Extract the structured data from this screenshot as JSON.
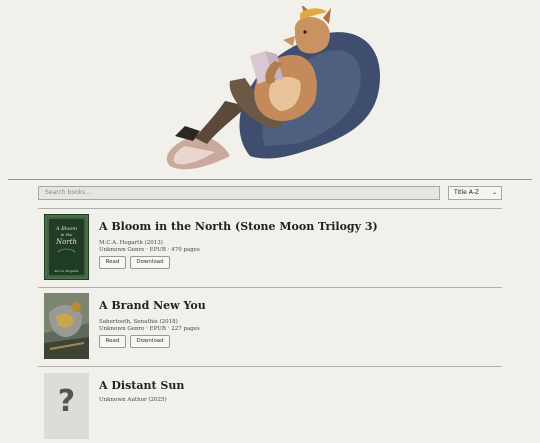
{
  "header": {
    "hero_alt": "fox reading on beanbag illustration"
  },
  "toolbar": {
    "search_placeholder": "Search books...",
    "sort_selected": "Title A-Z"
  },
  "books": [
    {
      "title": "A Bloom in the North (Stone Moon Trilogy 3)",
      "author_year": "M.C.A. Hogarth (2013)",
      "details": "Unknown Genre · EPUB · 470 pages",
      "read_label": "Read",
      "download_label": "Download",
      "cover_title": "A Bloom in the North",
      "cover_author": "M.C.A. Hogarth"
    },
    {
      "title": "A Brand New You",
      "author_year": "Sabertooth, Senathis (2018)",
      "details": "Unknown Genre · EPUB · 227 pages",
      "read_label": "Read",
      "download_label": "Download"
    },
    {
      "title": "A Distant Sun",
      "author_year": "Unknown Author (2025)",
      "cover_placeholder": "?"
    }
  ],
  "colors": {
    "background": "#f1f0ea",
    "cover1_green": "#1f3d26",
    "placeholder_grey": "#dcdcd8"
  }
}
